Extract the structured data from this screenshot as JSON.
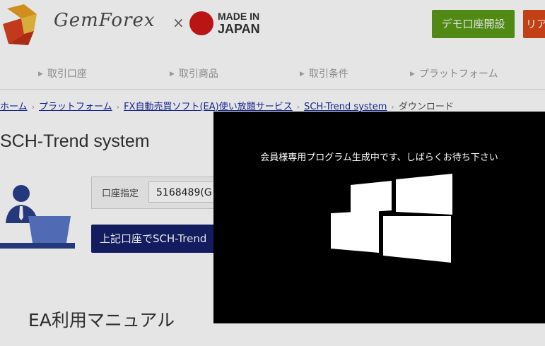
{
  "header": {
    "logo_text": "GemForex",
    "times": "×",
    "made_in_line1": "MADE IN",
    "made_in_line2": "JAPAN",
    "demo_button": "デモ口座開設",
    "real_button": "リアル口座開設"
  },
  "nav": {
    "items": [
      {
        "label": "取引口座"
      },
      {
        "label": "取引商品"
      },
      {
        "label": "取引条件"
      },
      {
        "label": "プラットフォーム"
      }
    ]
  },
  "breadcrumb": {
    "items": [
      "ホーム",
      "プラットフォーム",
      "FX自動売買ソフト(EA)使い放題サービス",
      "SCH-Trend system"
    ],
    "current": "ダウンロード"
  },
  "page": {
    "title": "SCH-Trend system",
    "account_label": "口座指定",
    "account_value": "5168489(G",
    "download_button": "上記口座でSCH-Trend",
    "manual_title": "EA利用マニュアル"
  },
  "overlay": {
    "message": "会員様専用プログラム生成中です、しばらくお待ち下さい"
  },
  "colors": {
    "demo_green": "#5a9a18",
    "real_orange": "#d94818",
    "navy_button": "#15206a",
    "link_blue": "#1a2aa0",
    "overlay_bg": "#000000"
  },
  "icons": [
    "gemforex-logo-icon",
    "japan-flag-icon",
    "nav-arrow-icon",
    "breadcrumb-chevron-icon",
    "user-avatar-icon",
    "windows-logo-icon"
  ]
}
